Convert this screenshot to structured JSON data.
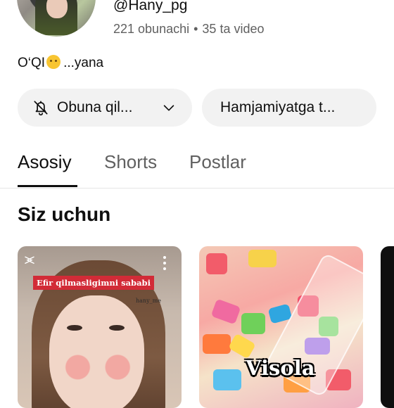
{
  "channel": {
    "handle": "@Hany_pg",
    "subscribers": "221 obunachi",
    "separator": "•",
    "videos": "35 ta video",
    "description_start": "O‘QI",
    "description_end": "...yana"
  },
  "actions": {
    "subscribe_label": "Obuna qil...",
    "community_label": "Hamjamiyatga t..."
  },
  "tabs": [
    {
      "label": "Asosiy",
      "selected": true
    },
    {
      "label": "Shorts",
      "selected": false
    },
    {
      "label": "Postlar",
      "selected": false
    }
  ],
  "section": {
    "title": "Siz uchun"
  },
  "shorts": [
    {
      "caption": "Efir qilmasligimni sababi",
      "watermark": "hany_me"
    },
    {
      "caption": "Visola"
    }
  ],
  "colors": {
    "text_primary": "#0f0f0f",
    "text_secondary": "#606060",
    "pill_bg": "#f2f2f2",
    "caption_red": "#d22b37"
  },
  "icons": [
    "bell-off-icon",
    "chevron-down-icon",
    "capcut-logo-icon",
    "more-vert-icon",
    "emoji-upside-down-face-icon"
  ]
}
